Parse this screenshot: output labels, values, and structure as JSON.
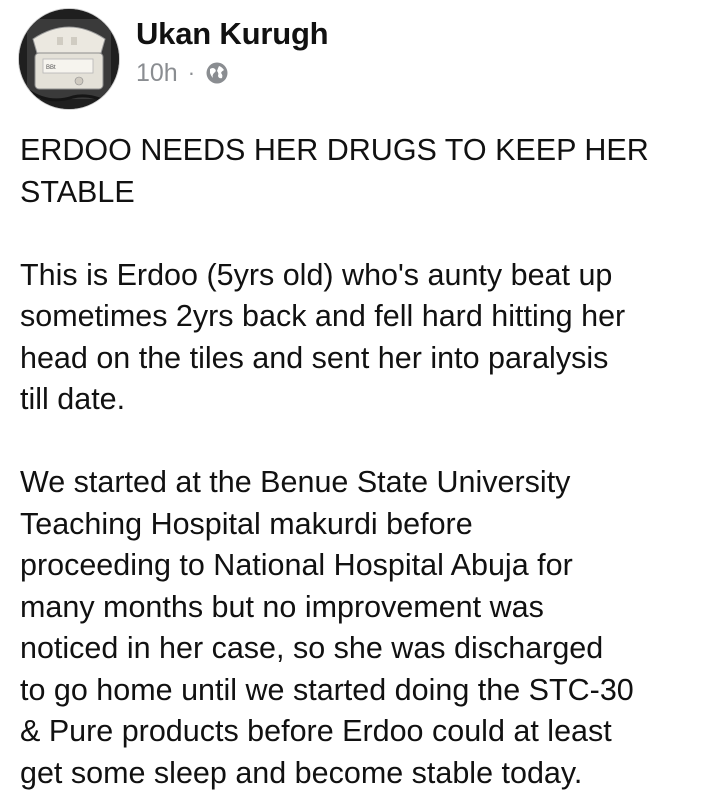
{
  "post": {
    "author": "Ukan Kurugh",
    "timestamp": "10h",
    "separator": "·",
    "privacy_icon": "globe-icon",
    "avatar_text": "BBt",
    "paragraphs": [
      "ERDOO NEEDS HER DRUGS TO KEEP HER\nSTABLE",
      "This is Erdoo (5yrs old) who's aunty beat up\nsometimes 2yrs back and fell hard hitting her\nhead on the tiles and sent her into paralysis\ntill date.",
      "We started at the Benue State University\nTeaching Hospital makurdi before\nproceeding to National Hospital Abuja for\nmany months but no improvement was\nnoticed in her case, so she was discharged\nto go home until we started doing the STC-30\n& Pure products before Erdoo could at least\nget some sleep and become stable today."
    ]
  },
  "colors": {
    "text": "#111111",
    "meta": "#8a8d91",
    "background": "#ffffff"
  }
}
